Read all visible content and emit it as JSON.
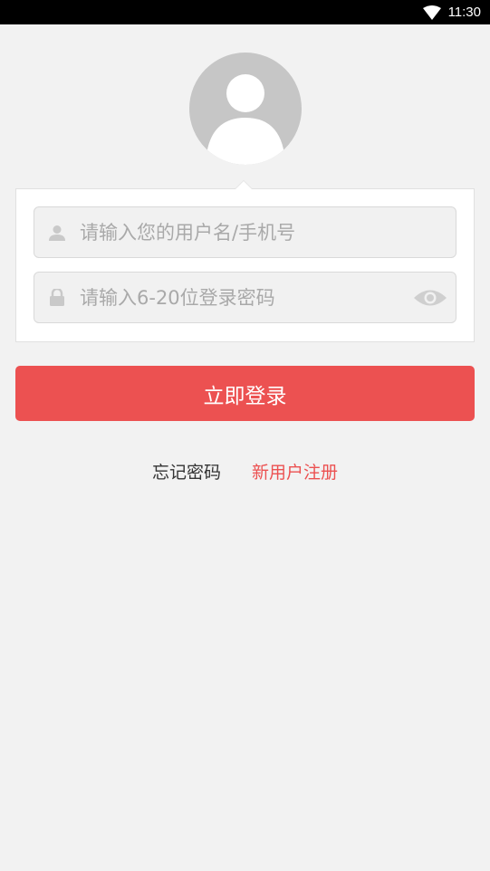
{
  "status_bar": {
    "time": "11:30",
    "icons": [
      "wifi-icon"
    ]
  },
  "avatar": {
    "icon": "user-avatar-icon"
  },
  "login_form": {
    "username_placeholder": "请输入您的用户名/手机号",
    "username_value": "",
    "password_placeholder": "请输入6-20位登录密码",
    "password_value": "",
    "username_icon": "person-icon",
    "password_icon": "lock-icon",
    "toggle_icon": "eye-icon"
  },
  "actions": {
    "login_label": "立即登录",
    "forgot_label": "忘记密码",
    "register_label": "新用户注册"
  },
  "colors": {
    "accent": "#ec5151",
    "background": "#f2f2f2"
  }
}
